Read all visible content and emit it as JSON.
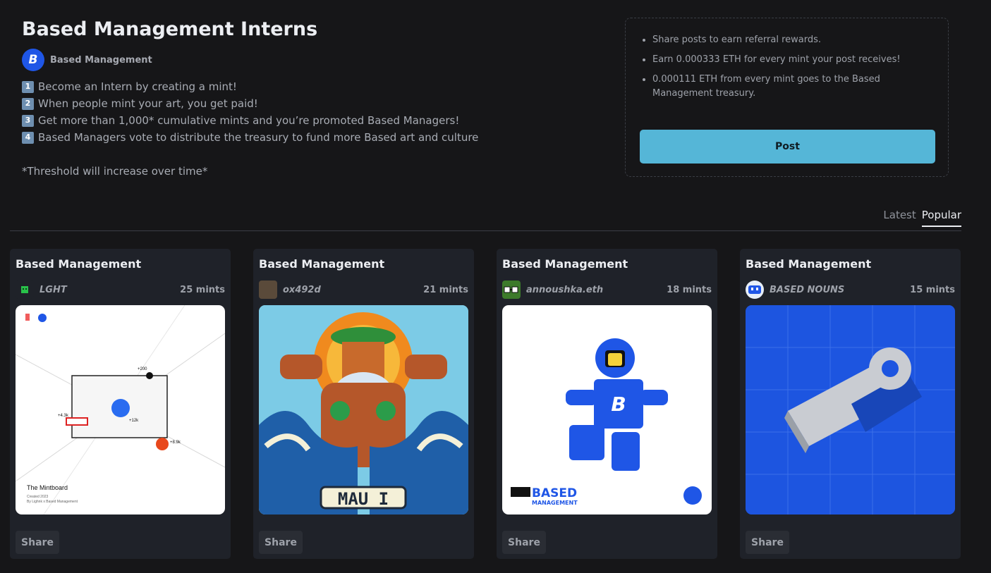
{
  "header": {
    "title": "Based Management Interns",
    "author_name": "Based Management",
    "author_avatar_letter": "B"
  },
  "description": {
    "steps": [
      {
        "num": "1",
        "text": "Become an Intern by creating a mint!"
      },
      {
        "num": "2",
        "text": "When people mint your art, you get paid!"
      },
      {
        "num": "3",
        "text": "Get more than 1,000* cumulative mints and you’re promoted Based Managers!"
      },
      {
        "num": "4",
        "text": "Based Managers vote to distribute the treasury to fund more Based art and culture"
      }
    ],
    "note": "*Threshold will increase over time*"
  },
  "info": {
    "bullets": [
      "Share posts to earn referral rewards.",
      "Earn 0.000333 ETH for every mint your post receives!",
      "0.000111 ETH from every mint goes to the Based Management treasury."
    ],
    "post_label": "Post"
  },
  "tabs": [
    "Latest",
    "Popular"
  ],
  "active_tab": "Popular",
  "cards": [
    {
      "title": "Based Management",
      "creator": "LGHT",
      "mints": "25 mints",
      "share_label": "Share",
      "image": {
        "heading": "The Mintboard",
        "created": "Created 2023",
        "byline": "By Lighnk x Based Management",
        "labels": [
          "+200",
          "+4.3k",
          "+12k",
          "+8.9k"
        ]
      }
    },
    {
      "title": "Based Management",
      "creator": "ox492d",
      "mints": "21 mints",
      "share_label": "Share",
      "image": {
        "banner": "MAU I"
      }
    },
    {
      "title": "Based Management",
      "creator": "annoushka.eth",
      "mints": "18 mints",
      "share_label": "Share",
      "image": {
        "brand_top": "BASED",
        "brand_bottom": "MANAGEMENT"
      }
    },
    {
      "title": "Based Management",
      "creator": "BASED NOUNS",
      "mints": "15 mints",
      "share_label": "Share",
      "image": {}
    }
  ],
  "colors": {
    "background": "#161618",
    "card": "#1f2229",
    "accent": "#55b6d7",
    "brand_blue": "#1f56e6"
  }
}
